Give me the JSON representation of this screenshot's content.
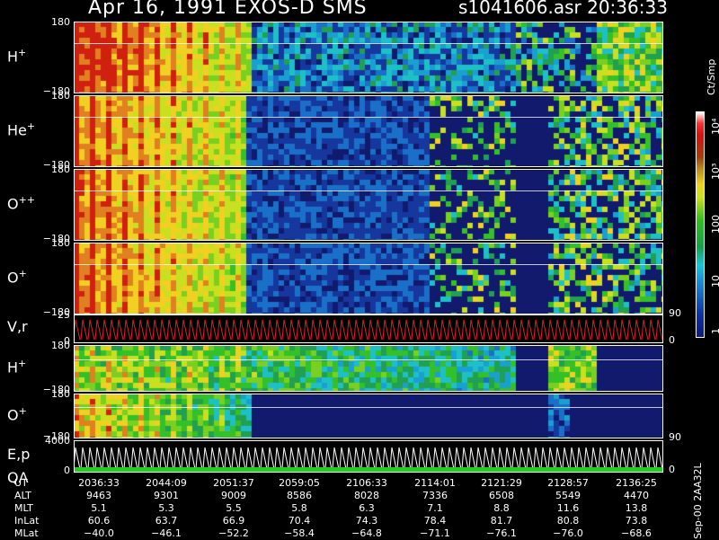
{
  "header": {
    "title": "Apr 16, 1991    EXOS-D SMS",
    "file_time": "s1041606.asr  20:36:33"
  },
  "panels": [
    {
      "label_main": "H",
      "label_sup": "+",
      "ytop": "180",
      "ybot": "−180"
    },
    {
      "label_main": "He",
      "label_sup": "+",
      "ytop": "180",
      "ybot": "−180"
    },
    {
      "label_main": "O",
      "label_sup": "++",
      "ytop": "180",
      "ybot": "−180"
    },
    {
      "label_main": "O",
      "label_sup": "+",
      "ytop": "180",
      "ybot": "−180"
    },
    {
      "label_main": "V,r",
      "label_sup": "",
      "ytop": "25",
      "ybot": "0",
      "right_top": "90",
      "right_bot": "0"
    },
    {
      "label_main": "H",
      "label_sup": "+",
      "ytop": "180",
      "ybot": "−180"
    },
    {
      "label_main": "O",
      "label_sup": "+",
      "ytop": "180",
      "ybot": "−180",
      "right_top": "90"
    },
    {
      "label_main": "E,p",
      "label_sub": "QA",
      "ytop": "4000",
      "ybot": "0",
      "right_bot": "0"
    }
  ],
  "colorbar": {
    "unit": "Ct/Smp",
    "labels": [
      "10⁴",
      "10³",
      "100",
      "10",
      "1"
    ]
  },
  "axis": {
    "rows": [
      {
        "label": "UT",
        "values": [
          "2036:33",
          "2044:09",
          "2051:37",
          "2059:05",
          "2106:33",
          "2114:01",
          "2121:29",
          "2128:57",
          "2136:25"
        ]
      },
      {
        "label": "ALT",
        "values": [
          "9463",
          "9301",
          "9009",
          "8586",
          "8028",
          "7336",
          "6508",
          "5549",
          "4470"
        ]
      },
      {
        "label": "MLT",
        "values": [
          "5.1",
          "5.3",
          "5.5",
          "5.8",
          "6.3",
          "7.1",
          "8.8",
          "11.6",
          "13.8"
        ]
      },
      {
        "label": "InLat",
        "values": [
          "60.6",
          "63.7",
          "66.9",
          "70.4",
          "74.3",
          "78.4",
          "81.7",
          "80.8",
          "73.8"
        ]
      },
      {
        "label": "MLat",
        "values": [
          "−40.0",
          "−46.1",
          "−52.2",
          "−58.4",
          "−64.8",
          "−71.1",
          "−76.1",
          "−76.0",
          "−68.6"
        ]
      }
    ]
  },
  "side_id": "Sep-00  2AA32L",
  "colors": {
    "background": "#000000",
    "panel_fill": "#121a6e",
    "line": "#ffffff",
    "velocity_trace": "#e02020",
    "qa_trace": "#20d020"
  },
  "chart_data": {
    "type": "heatmap",
    "title": "Apr 16, 1991    EXOS-D SMS",
    "xlabel": "UT",
    "x_ticks": [
      "2036:33",
      "2044:09",
      "2051:37",
      "2059:05",
      "2106:33",
      "2114:01",
      "2121:29",
      "2128:57",
      "2136:25"
    ],
    "panels": [
      "H+",
      "He+",
      "O++",
      "O+",
      "V,r",
      "H+",
      "O+",
      "E,p / QA"
    ],
    "ylim_pitch": [
      -180,
      180
    ],
    "colorbar_scale": "log",
    "colorbar_range": [
      1,
      10000
    ],
    "colorbar_unit": "Ct/Smp"
  }
}
